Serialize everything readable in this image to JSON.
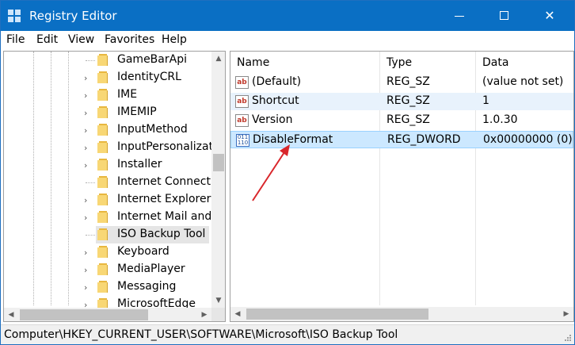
{
  "window": {
    "title": "Registry Editor",
    "minimize_glyph": "—",
    "close_glyph": "✕"
  },
  "menu": [
    "File",
    "Edit",
    "View",
    "Favorites",
    "Help"
  ],
  "tree": {
    "items": [
      {
        "label": "GameBarApi",
        "has_children": false
      },
      {
        "label": "IdentityCRL",
        "has_children": true
      },
      {
        "label": "IME",
        "has_children": true
      },
      {
        "label": "IMEMIP",
        "has_children": true
      },
      {
        "label": "InputMethod",
        "has_children": true
      },
      {
        "label": "InputPersonalizati",
        "has_children": true
      },
      {
        "label": "Installer",
        "has_children": true
      },
      {
        "label": "Internet Connecti",
        "has_children": false
      },
      {
        "label": "Internet Explorer",
        "has_children": true
      },
      {
        "label": "Internet Mail and",
        "has_children": true
      },
      {
        "label": "ISO Backup Tool",
        "has_children": false,
        "selected": true
      },
      {
        "label": "Keyboard",
        "has_children": true
      },
      {
        "label": "MediaPlayer",
        "has_children": true
      },
      {
        "label": "Messaging",
        "has_children": true
      },
      {
        "label": "MicrosoftEdge",
        "has_children": true
      }
    ],
    "expander_glyph": "›",
    "scroll_up_glyph": "▲",
    "scroll_down_glyph": "▼",
    "scroll_left_glyph": "◀",
    "scroll_right_glyph": "▶"
  },
  "list": {
    "columns": [
      "Name",
      "Type",
      "Data"
    ],
    "rows": [
      {
        "icon": "string-value-icon",
        "icon_text": "ab",
        "name": "(Default)",
        "type": "REG_SZ",
        "data": "(value not set)"
      },
      {
        "icon": "string-value-icon",
        "icon_text": "ab",
        "name": "Shortcut",
        "type": "REG_SZ",
        "data": "1"
      },
      {
        "icon": "string-value-icon",
        "icon_text": "ab",
        "name": "Version",
        "type": "REG_SZ",
        "data": "1.0.30"
      },
      {
        "icon": "dword-value-icon",
        "icon_text": "011 110",
        "name": "DisableFormat",
        "type": "REG_DWORD",
        "data": "0x00000000 (0)",
        "selected": true
      }
    ],
    "scroll_left_glyph": "◀",
    "scroll_right_glyph": "▶"
  },
  "status_bar": {
    "path": "Computer\\HKEY_CURRENT_USER\\SOFTWARE\\Microsoft\\ISO Backup Tool"
  },
  "colors": {
    "titlebar": "#0a6fc4",
    "selection": "#cce8ff",
    "annotation_arrow": "#d9262b"
  }
}
